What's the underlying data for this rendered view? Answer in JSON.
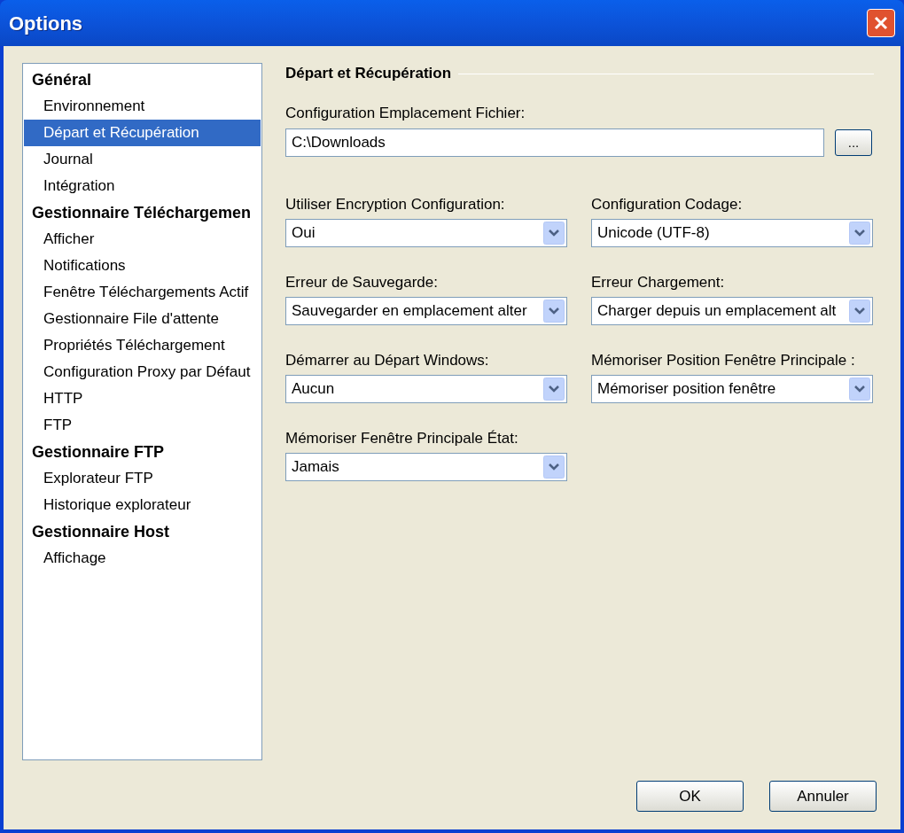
{
  "window": {
    "title": "Options"
  },
  "sidebar": {
    "items": [
      {
        "label": "Général",
        "children": [
          {
            "label": "Environnement",
            "selected": false
          },
          {
            "label": "Départ et Récupération",
            "selected": true
          },
          {
            "label": "Journal",
            "selected": false
          },
          {
            "label": "Intégration",
            "selected": false
          }
        ]
      },
      {
        "label": "Gestionnaire Téléchargemen",
        "children": [
          {
            "label": "Afficher",
            "selected": false
          },
          {
            "label": "Notifications",
            "selected": false
          },
          {
            "label": "Fenêtre Téléchargements Actif",
            "selected": false
          },
          {
            "label": "Gestionnaire File d'attente",
            "selected": false
          },
          {
            "label": "Propriétés Téléchargement",
            "selected": false
          },
          {
            "label": "Configuration Proxy par Défaut",
            "selected": false
          },
          {
            "label": "HTTP",
            "selected": false
          },
          {
            "label": "FTP",
            "selected": false
          }
        ]
      },
      {
        "label": "Gestionnaire FTP",
        "children": [
          {
            "label": "Explorateur FTP",
            "selected": false
          },
          {
            "label": "Historique explorateur",
            "selected": false
          }
        ]
      },
      {
        "label": "Gestionnaire Host",
        "children": [
          {
            "label": "Affichage",
            "selected": false
          }
        ]
      }
    ]
  },
  "section": {
    "title": "Départ et Récupération",
    "path_field": {
      "label": "Configuration Emplacement Fichier:",
      "value": "C:\\Downloads",
      "browse": "..."
    },
    "dropdowns": [
      {
        "label": "Utiliser Encryption Configuration:",
        "value": "Oui"
      },
      {
        "label": "Configuration Codage:",
        "value": "Unicode (UTF-8)"
      },
      {
        "label": "Erreur de Sauvegarde:",
        "value": "Sauvegarder en emplacement alter"
      },
      {
        "label": "Erreur Chargement:",
        "value": "Charger depuis un emplacement alt"
      },
      {
        "label": "Démarrer au Départ Windows:",
        "value": "Aucun"
      },
      {
        "label": "Mémoriser Position Fenêtre Principale :",
        "value": "Mémoriser position fenêtre"
      },
      {
        "label": "Mémoriser Fenêtre Principale État:",
        "value": "Jamais"
      }
    ]
  },
  "buttons": [
    "OK",
    "Annuler"
  ]
}
